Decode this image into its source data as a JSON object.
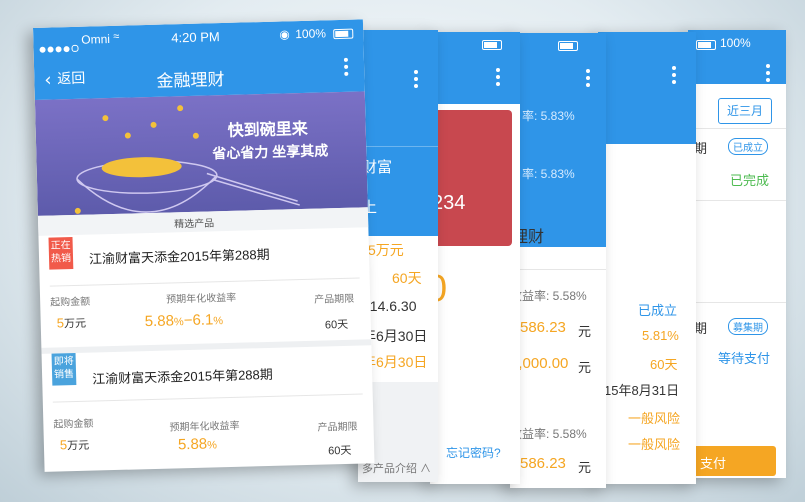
{
  "front": {
    "status": {
      "carrier": "Omni",
      "time": "4:20 PM",
      "battery": "100%"
    },
    "nav": {
      "back": "返回",
      "title": "金融理财"
    },
    "banner": {
      "line1": "快到碗里来",
      "line2": "省心省力  坐享其成"
    },
    "section_label": "精选产品",
    "products": [
      {
        "badge": "正在\n热销",
        "name": "江渝财富天添金2015年第288期",
        "col1_label": "起购金额",
        "col1_num": "5",
        "col1_unit": "万元",
        "col2_label": "预期年化收益率",
        "col2_a": "5.88",
        "col2_pct1": "%",
        "col2_dash": "−",
        "col2_b": "6.1",
        "col2_pct2": "%",
        "col3_label": "产品期限",
        "col3_value": "60天"
      },
      {
        "badge": "即将\n销售",
        "name": "江渝财富天添金2015年第288期",
        "col1_label": "起购金额",
        "col1_num": "5",
        "col1_unit": "万元",
        "col2_label": "预期年化收益率",
        "col2_a": "5.88",
        "col2_pct1": "%",
        "col3_label": "产品期限",
        "col3_value": "60天"
      }
    ]
  },
  "s2": {
    "header": "财富",
    "sub": "上",
    "rows": [
      "5万元",
      "60天",
      "014.6.30",
      "年6月30日",
      "年6月30日"
    ],
    "footer": "多产品介绍 ∧"
  },
  "s3": {
    "amount": "234",
    "big": "0",
    "link": "忘记密码?"
  },
  "s4": {
    "rate1": "率: 5.83%",
    "rate2": "率: 5.83%",
    "title": "理财",
    "r1": "收益率: 5.58%",
    "v1": "586.23",
    "u1": "元",
    "v2": "0,000.00",
    "u2": "元",
    "r2": "收益率: 5.58%",
    "v3": "586.23",
    "u3": "元"
  },
  "s5": {
    "rows": [
      "已成立",
      "5.81%",
      "60天",
      "15年8月31日",
      "一般风险",
      "一般风险"
    ]
  },
  "s6": {
    "battery": "100%",
    "tab": "近三月",
    "items": [
      {
        "label": "期",
        "tag": "已成立",
        "status": "已完成"
      },
      {
        "label": "期",
        "tag": "募集期",
        "status": "等待支付"
      }
    ],
    "pay": "支付"
  },
  "colors": {
    "blue": "#2f95e8",
    "orange": "#f5a623",
    "banner": "#6c66b8",
    "red_card": "#c8484f"
  }
}
